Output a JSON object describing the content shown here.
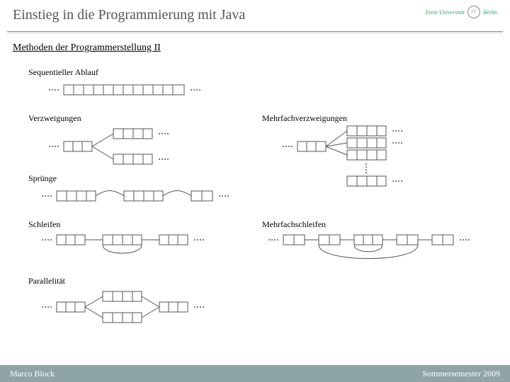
{
  "header": {
    "title": "Einstieg in die Programmierung mit Java",
    "logo_text": "Freie Universität",
    "logo_city": "Berlin"
  },
  "subtitle": "Methoden der Programmerstellung II",
  "sections": {
    "seq": "Sequentieller Ablauf",
    "branch": "Verzweigungen",
    "multibranch": "Mehrfachverzweigungen",
    "jumps": "Sprünge",
    "loops": "Schleifen",
    "multiloops": "Mehrfachschleifen",
    "parallel": "Parallelität"
  },
  "footer": {
    "author": "Marco Block",
    "term": "Sommersemester 2009"
  }
}
